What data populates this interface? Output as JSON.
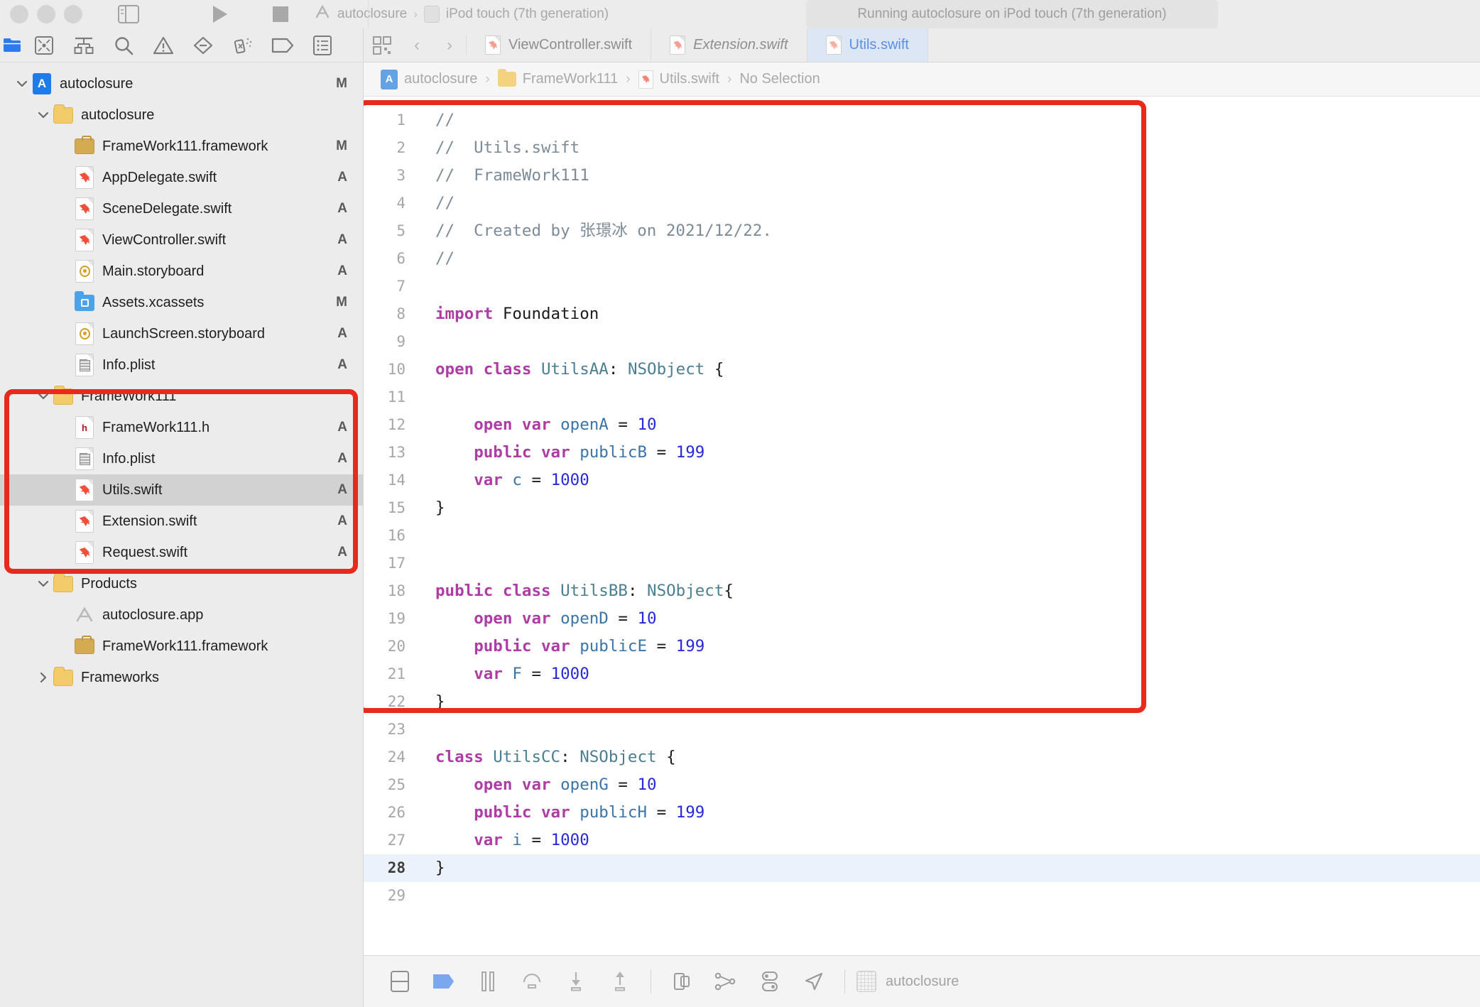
{
  "window": {
    "traffic_lights": [
      "close",
      "minimize",
      "zoom"
    ]
  },
  "toolbar": {
    "sidebar_toggle": "toggle-navigator",
    "run_label": "Run",
    "stop_label": "Stop",
    "scheme_name": "autoclosure",
    "scheme_separator": "›",
    "destination": "iPod touch (7th generation)",
    "status": "Running autoclosure on iPod touch (7th generation)"
  },
  "navigator": {
    "tabs": [
      {
        "name": "project-navigator",
        "icon": "folder-icon",
        "active": true
      },
      {
        "name": "source-control-navigator",
        "icon": "source-control-icon",
        "active": false
      },
      {
        "name": "symbol-navigator",
        "icon": "hierarchy-icon",
        "active": false
      },
      {
        "name": "find-navigator",
        "icon": "search-icon",
        "active": false
      },
      {
        "name": "issue-navigator",
        "icon": "warning-icon",
        "active": false
      },
      {
        "name": "test-navigator",
        "icon": "diamond-icon",
        "active": false
      },
      {
        "name": "debug-navigator",
        "icon": "spray-icon",
        "active": false
      },
      {
        "name": "breakpoint-navigator",
        "icon": "tag-icon",
        "active": false
      },
      {
        "name": "report-navigator",
        "icon": "report-icon",
        "active": false
      }
    ],
    "items": [
      {
        "label": "autoclosure",
        "icon": "xcodeproj-icon",
        "badge": "M",
        "indent": 0,
        "twisty": "down",
        "selected": false
      },
      {
        "label": "autoclosure",
        "icon": "folder-icon",
        "badge": "",
        "indent": 1,
        "twisty": "down",
        "selected": false
      },
      {
        "label": "FrameWork111.framework",
        "icon": "framework-icon",
        "badge": "M",
        "indent": 2,
        "twisty": "none",
        "selected": false
      },
      {
        "label": "AppDelegate.swift",
        "icon": "swift-icon",
        "badge": "A",
        "indent": 2,
        "twisty": "none",
        "selected": false
      },
      {
        "label": "SceneDelegate.swift",
        "icon": "swift-icon",
        "badge": "A",
        "indent": 2,
        "twisty": "none",
        "selected": false
      },
      {
        "label": "ViewController.swift",
        "icon": "swift-icon",
        "badge": "A",
        "indent": 2,
        "twisty": "none",
        "selected": false
      },
      {
        "label": "Main.storyboard",
        "icon": "storyboard-icon",
        "badge": "A",
        "indent": 2,
        "twisty": "none",
        "selected": false
      },
      {
        "label": "Assets.xcassets",
        "icon": "xcassets-icon",
        "badge": "M",
        "indent": 2,
        "twisty": "none",
        "selected": false
      },
      {
        "label": "LaunchScreen.storyboard",
        "icon": "storyboard-icon",
        "badge": "A",
        "indent": 2,
        "twisty": "none",
        "selected": false
      },
      {
        "label": "Info.plist",
        "icon": "plist-icon",
        "badge": "A",
        "indent": 2,
        "twisty": "none",
        "selected": false
      },
      {
        "label": "FrameWork111",
        "icon": "folder-icon",
        "badge": "",
        "indent": 1,
        "twisty": "down",
        "selected": false
      },
      {
        "label": "FrameWork111.h",
        "icon": "header-icon",
        "badge": "A",
        "indent": 2,
        "twisty": "none",
        "selected": false
      },
      {
        "label": "Info.plist",
        "icon": "plist-icon",
        "badge": "A",
        "indent": 2,
        "twisty": "none",
        "selected": false
      },
      {
        "label": "Utils.swift",
        "icon": "swift-icon",
        "badge": "A",
        "indent": 2,
        "twisty": "none",
        "selected": true
      },
      {
        "label": "Extension.swift",
        "icon": "swift-icon",
        "badge": "A",
        "indent": 2,
        "twisty": "none",
        "selected": false
      },
      {
        "label": "Request.swift",
        "icon": "swift-icon",
        "badge": "A",
        "indent": 2,
        "twisty": "none",
        "selected": false
      },
      {
        "label": "Products",
        "icon": "folder-icon",
        "badge": "",
        "indent": 1,
        "twisty": "down",
        "selected": false
      },
      {
        "label": "autoclosure.app",
        "icon": "app-icon",
        "badge": "",
        "indent": 2,
        "twisty": "none",
        "selected": false
      },
      {
        "label": "FrameWork111.framework",
        "icon": "framework-icon",
        "badge": "",
        "indent": 2,
        "twisty": "none",
        "selected": false
      },
      {
        "label": "Frameworks",
        "icon": "folder-icon",
        "badge": "",
        "indent": 1,
        "twisty": "right",
        "selected": false
      }
    ]
  },
  "editor": {
    "toolbar_buttons": [
      {
        "name": "related-items-button",
        "icon": "grid-icon"
      },
      {
        "name": "back-button",
        "icon": "chevron-left-icon",
        "glyph": "‹"
      },
      {
        "name": "forward-button",
        "icon": "chevron-right-icon",
        "glyph": "›"
      }
    ],
    "tabs": [
      {
        "label": "ViewController.swift",
        "active": false,
        "italic": false
      },
      {
        "label": "Extension.swift",
        "active": false,
        "italic": true
      },
      {
        "label": "Utils.swift",
        "active": true,
        "italic": false
      }
    ],
    "breadcrumb": [
      {
        "label": "autoclosure",
        "icon": "xcodeproj-icon"
      },
      {
        "label": "FrameWork111",
        "icon": "folder-icon"
      },
      {
        "label": "Utils.swift",
        "icon": "swift-icon"
      },
      {
        "label": "No Selection",
        "icon": "none"
      }
    ],
    "breadcrumb_separator": "›",
    "current_line": 28,
    "lines": [
      {
        "n": 1,
        "tokens": [
          [
            "cm",
            "//"
          ]
        ]
      },
      {
        "n": 2,
        "tokens": [
          [
            "cm",
            "//  Utils.swift"
          ]
        ]
      },
      {
        "n": 3,
        "tokens": [
          [
            "cm",
            "//  FrameWork111"
          ]
        ]
      },
      {
        "n": 4,
        "tokens": [
          [
            "cm",
            "//"
          ]
        ]
      },
      {
        "n": 5,
        "tokens": [
          [
            "cm",
            "//  Created by 张璟冰 on 2021/12/22."
          ]
        ]
      },
      {
        "n": 6,
        "tokens": [
          [
            "cm",
            "//"
          ]
        ]
      },
      {
        "n": 7,
        "tokens": []
      },
      {
        "n": 8,
        "tokens": [
          [
            "k",
            "import"
          ],
          [
            "p",
            " Foundation"
          ]
        ]
      },
      {
        "n": 9,
        "tokens": []
      },
      {
        "n": 10,
        "tokens": [
          [
            "k",
            "open class"
          ],
          [
            "p",
            " "
          ],
          [
            "t",
            "UtilsAA"
          ],
          [
            "p",
            ": "
          ],
          [
            "t",
            "NSObject"
          ],
          [
            "p",
            " {"
          ]
        ]
      },
      {
        "n": 11,
        "tokens": []
      },
      {
        "n": 12,
        "tokens": [
          [
            "p",
            "    "
          ],
          [
            "k",
            "open var"
          ],
          [
            "p",
            " "
          ],
          [
            "id",
            "openA"
          ],
          [
            "p",
            " = "
          ],
          [
            "n",
            "10"
          ]
        ]
      },
      {
        "n": 13,
        "tokens": [
          [
            "p",
            "    "
          ],
          [
            "k",
            "public var"
          ],
          [
            "p",
            " "
          ],
          [
            "id",
            "publicB"
          ],
          [
            "p",
            " = "
          ],
          [
            "n",
            "199"
          ]
        ]
      },
      {
        "n": 14,
        "tokens": [
          [
            "p",
            "    "
          ],
          [
            "k",
            "var"
          ],
          [
            "p",
            " "
          ],
          [
            "id",
            "c"
          ],
          [
            "p",
            " = "
          ],
          [
            "n",
            "1000"
          ]
        ]
      },
      {
        "n": 15,
        "tokens": [
          [
            "p",
            "}"
          ]
        ]
      },
      {
        "n": 16,
        "tokens": []
      },
      {
        "n": 17,
        "tokens": []
      },
      {
        "n": 18,
        "tokens": [
          [
            "k",
            "public class"
          ],
          [
            "p",
            " "
          ],
          [
            "t",
            "UtilsBB"
          ],
          [
            "p",
            ": "
          ],
          [
            "t",
            "NSObject"
          ],
          [
            "p",
            "{"
          ]
        ]
      },
      {
        "n": 19,
        "tokens": [
          [
            "p",
            "    "
          ],
          [
            "k",
            "open var"
          ],
          [
            "p",
            " "
          ],
          [
            "id",
            "openD"
          ],
          [
            "p",
            " = "
          ],
          [
            "n",
            "10"
          ]
        ]
      },
      {
        "n": 20,
        "tokens": [
          [
            "p",
            "    "
          ],
          [
            "k",
            "public var"
          ],
          [
            "p",
            " "
          ],
          [
            "id",
            "publicE"
          ],
          [
            "p",
            " = "
          ],
          [
            "n",
            "199"
          ]
        ]
      },
      {
        "n": 21,
        "tokens": [
          [
            "p",
            "    "
          ],
          [
            "k",
            "var"
          ],
          [
            "p",
            " "
          ],
          [
            "id",
            "F"
          ],
          [
            "p",
            " = "
          ],
          [
            "n",
            "1000"
          ]
        ]
      },
      {
        "n": 22,
        "tokens": [
          [
            "p",
            "}"
          ]
        ]
      },
      {
        "n": 23,
        "tokens": []
      },
      {
        "n": 24,
        "tokens": [
          [
            "k",
            "class"
          ],
          [
            "p",
            " "
          ],
          [
            "t",
            "UtilsCC"
          ],
          [
            "p",
            ": "
          ],
          [
            "t",
            "NSObject"
          ],
          [
            "p",
            " {"
          ]
        ]
      },
      {
        "n": 25,
        "tokens": [
          [
            "p",
            "    "
          ],
          [
            "k",
            "open var"
          ],
          [
            "p",
            " "
          ],
          [
            "id",
            "openG"
          ],
          [
            "p",
            " = "
          ],
          [
            "n",
            "10"
          ]
        ]
      },
      {
        "n": 26,
        "tokens": [
          [
            "p",
            "    "
          ],
          [
            "k",
            "public var"
          ],
          [
            "p",
            " "
          ],
          [
            "id",
            "publicH"
          ],
          [
            "p",
            " = "
          ],
          [
            "n",
            "199"
          ]
        ]
      },
      {
        "n": 27,
        "tokens": [
          [
            "p",
            "    "
          ],
          [
            "k",
            "var"
          ],
          [
            "p",
            " "
          ],
          [
            "id",
            "i"
          ],
          [
            "p",
            " = "
          ],
          [
            "n",
            "1000"
          ]
        ]
      },
      {
        "n": 28,
        "tokens": [
          [
            "p",
            "}"
          ]
        ]
      },
      {
        "n": 29,
        "tokens": []
      }
    ]
  },
  "debug_bar": {
    "buttons": [
      {
        "name": "toggle-console-button",
        "icon": "console-icon"
      },
      {
        "name": "breakpoints-button",
        "icon": "breakpoint-icon"
      },
      {
        "name": "pause-button",
        "icon": "pause-icon"
      },
      {
        "name": "step-over-button",
        "icon": "step-over-icon"
      },
      {
        "name": "step-into-button",
        "icon": "step-into-icon"
      },
      {
        "name": "step-out-button",
        "icon": "step-out-icon"
      },
      {
        "name": "view-hierarchy-button",
        "icon": "view-hierarchy-icon"
      },
      {
        "name": "memory-graph-button",
        "icon": "memory-graph-icon"
      },
      {
        "name": "environment-overrides-button",
        "icon": "environment-overrides-icon"
      },
      {
        "name": "simulate-location-button",
        "icon": "location-arrow-icon"
      }
    ],
    "process_name": "autoclosure"
  },
  "annotations": {
    "sidebar_box": {
      "label": "framework-group-highlight",
      "color": "#e8291b"
    },
    "code_box": {
      "label": "code-block-highlight",
      "color": "#e8291b"
    }
  },
  "colors": {
    "accent_red": "#e8291b",
    "keyword": "#ad3da4",
    "type": "#4b7e91",
    "number": "#272ad8",
    "property": "#3a74a8",
    "comment": "#7d8b99",
    "current_line": "#ecf2fc",
    "active_tab": "#dde6f5",
    "active_tab_text": "#5b8fe0",
    "selection": "#d2d2d2"
  }
}
